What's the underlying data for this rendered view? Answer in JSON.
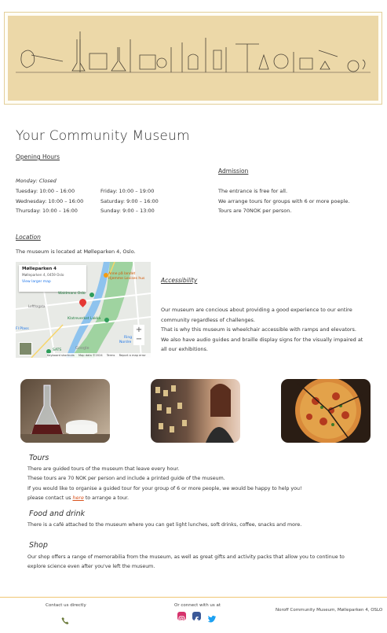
{
  "page": {
    "title": "Your Community Museum"
  },
  "opening_hours": {
    "heading": "Opening Hours",
    "closed": "Monday: Closed",
    "col1": [
      "Tuesday: 10:00 – 16:00",
      "Wednesday: 10:00 – 16:00",
      "Thursday: 10:00 – 16:00"
    ],
    "col2": [
      "Friday: 10:00 – 19:00",
      "Saturday: 9:00 – 16:00",
      "Sunday: 9:00 – 13:00"
    ]
  },
  "admission": {
    "heading": "Admission",
    "lines": [
      "The entrance is free for all.",
      "We arrange tours for groups with 6 or more poeple.",
      "Tours are 70NOK per person."
    ]
  },
  "location": {
    "heading": "Location",
    "text": "The museum is located at Mølleparken 4, Oslo.",
    "map": {
      "place_name": "Mølleparken 4",
      "address": "Mølleparken 4, 0459 Oslo",
      "view_larger": "View larger map",
      "labels": [
        "Anne på landet",
        "Hjemme Lovises hus",
        "Waldmans Oslo",
        "Klatreverket Lakka",
        "SATS",
        "Fl Plass",
        "Lofthagata",
        "Ring",
        "Nordre",
        "Google",
        "Keyboard shortcuts",
        "Map data ©2024",
        "Terms",
        "Report a map error"
      ]
    }
  },
  "accessibility": {
    "heading": "Accessibility",
    "lines": [
      "Our museum are concious about providing a good experience to our entire",
      "community regardless of challenges.",
      "That is why this museum is wheelchair accessible with ramps and elevators.",
      "We also have audio guides and braille display signs for the visually impaired at",
      "all our exhibitions."
    ]
  },
  "photos": [
    {
      "name": "chemistry-coffee-photo"
    },
    {
      "name": "shop-visitor-photo"
    },
    {
      "name": "pizza-photo"
    }
  ],
  "tours": {
    "heading": "Tours",
    "lines": [
      "There are guided tours of the museum that leave every hour.",
      "These tours are 70 NOK per person and include a printed guide of the museum.",
      "If you would like to organise a guided tour for your group of 6 or more people, we would be happy to help you!"
    ],
    "contact_prefix": "please contact us ",
    "contact_link": "here",
    "contact_suffix": " to arrange a tour."
  },
  "food": {
    "heading": "Food and drink",
    "text": "There is a café attached to the museum where you can get light lunches, soft drinks, coffee, snacks and more."
  },
  "shop": {
    "heading": "Shop",
    "lines": [
      "Our shop offers a range of memorabilia from the museum, as well as great gifts and activity packs that allow you to continue to",
      "explore science even after you've left the museum."
    ]
  },
  "footer": {
    "contact_label": "Contact us directly",
    "connect_label": "Or connect with us at",
    "address": "Noroff Community Museum, Mølleparken 4, OSLO",
    "socials": [
      "instagram-icon",
      "facebook-icon",
      "twitter-icon"
    ],
    "colors": {
      "instagram": "#d6336c",
      "facebook": "#3b5998",
      "twitter": "#1da1f2"
    }
  }
}
